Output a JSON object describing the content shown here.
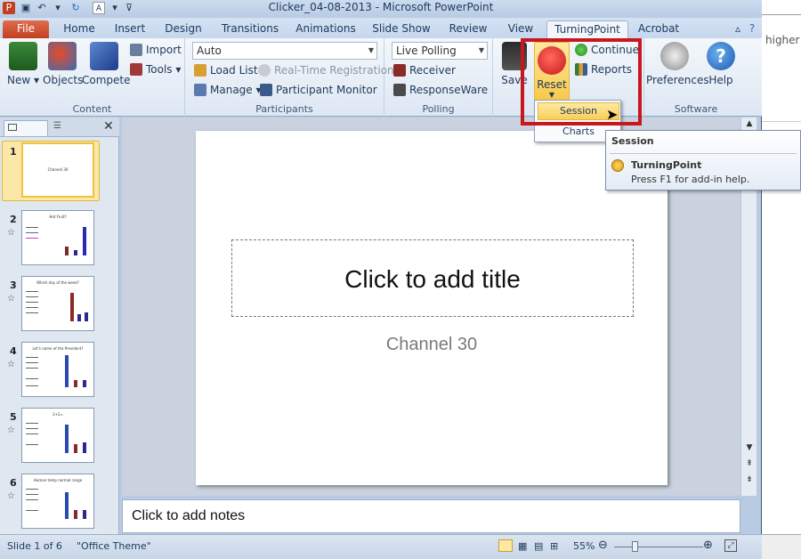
{
  "window": {
    "title": "Clicker_04-08-2013 - Microsoft PowerPoint"
  },
  "tabs": [
    "File",
    "Home",
    "Insert",
    "Design",
    "Transitions",
    "Animations",
    "Slide Show",
    "Review",
    "View",
    "TurningPoint",
    "Acrobat"
  ],
  "ribbon": {
    "content": {
      "label": "Content",
      "new": "New",
      "objects": "Objects",
      "compete": "Compete",
      "import": "Import",
      "tools": "Tools"
    },
    "participants": {
      "label": "Participants",
      "combo_value": "Auto",
      "load_list": "Load List",
      "realtime": "Real-Time Registration",
      "manage": "Manage",
      "monitor": "Participant Monitor"
    },
    "polling": {
      "label": "Polling",
      "combo_value": "Live Polling",
      "receiver": "Receiver",
      "responseware": "ResponseWare"
    },
    "session": {
      "save": "Save",
      "reset": "Reset",
      "continue": "Continue",
      "reports": "Reports"
    },
    "software": {
      "label": "Software",
      "preferences": "Preferences",
      "help": "Help"
    }
  },
  "dropdown": {
    "items": [
      "Session",
      "Charts"
    ]
  },
  "tooltip": {
    "title": "Session",
    "name": "TurningPoint",
    "help": "Press F1 for add-in help."
  },
  "slides": [
    {
      "num": "1",
      "title": "Channel 30"
    },
    {
      "num": "2",
      "title": "Hot Fruit?"
    },
    {
      "num": "3",
      "title": "Which day of the week?"
    },
    {
      "num": "4",
      "title": "Let's name of the President?"
    },
    {
      "num": "5",
      "title": "2+2="
    },
    {
      "num": "6",
      "title": "Human temp normal range"
    }
  ],
  "slide": {
    "title_placeholder": "Click to add title",
    "subtitle": "Channel 30"
  },
  "notes": {
    "placeholder": "Click to add notes"
  },
  "status": {
    "slide": "Slide 1 of 6",
    "theme": "\"Office Theme\"",
    "zoom": "55%"
  },
  "background": {
    "right_text": "higher"
  },
  "colors": {
    "accent": "#c8171e",
    "file_tab": "#d04a2a",
    "ribbon": "#dde7f3"
  }
}
